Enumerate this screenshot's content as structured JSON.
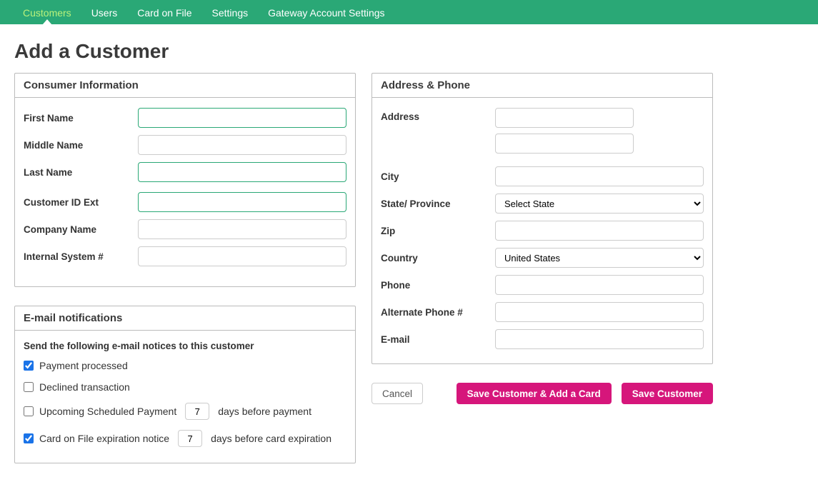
{
  "nav": {
    "items": [
      {
        "label": "Customers",
        "active": true
      },
      {
        "label": "Users"
      },
      {
        "label": "Card on File"
      },
      {
        "label": "Settings"
      },
      {
        "label": "Gateway Account Settings"
      }
    ]
  },
  "page_title": "Add a Customer",
  "panels": {
    "consumer": {
      "title": "Consumer Information",
      "fields": {
        "first_name": {
          "label": "First Name",
          "value": ""
        },
        "middle_name": {
          "label": "Middle Name",
          "value": ""
        },
        "last_name": {
          "label": "Last Name",
          "value": ""
        },
        "customer_id_ext": {
          "label": "Customer ID Ext",
          "value": ""
        },
        "company_name": {
          "label": "Company Name",
          "value": ""
        },
        "internal_system": {
          "label": "Internal System #",
          "value": ""
        }
      }
    },
    "email_notifications": {
      "title": "E-mail notifications",
      "intro": "Send the following e-mail notices to this customer",
      "items": {
        "payment_processed": {
          "label": "Payment processed",
          "checked": true
        },
        "declined_transaction": {
          "label": "Declined transaction",
          "checked": false
        },
        "upcoming_scheduled": {
          "label": "Upcoming Scheduled Payment",
          "checked": false,
          "days": "7",
          "suffix": "days before payment"
        },
        "card_expiration": {
          "label": "Card on File expiration notice",
          "checked": true,
          "days": "7",
          "suffix": "days before card expiration"
        }
      }
    },
    "address": {
      "title": "Address & Phone",
      "fields": {
        "address": {
          "label": "Address",
          "value1": "",
          "value2": ""
        },
        "city": {
          "label": "City",
          "value": ""
        },
        "state": {
          "label": "State/ Province",
          "selected": "Select State"
        },
        "zip": {
          "label": "Zip",
          "value": ""
        },
        "country": {
          "label": "Country",
          "selected": "United States"
        },
        "phone": {
          "label": "Phone",
          "value": ""
        },
        "alt_phone": {
          "label": "Alternate Phone #",
          "value": ""
        },
        "email": {
          "label": "E-mail",
          "value": ""
        }
      }
    }
  },
  "actions": {
    "cancel": "Cancel",
    "save_add_card": "Save Customer & Add a Card",
    "save": "Save Customer"
  }
}
